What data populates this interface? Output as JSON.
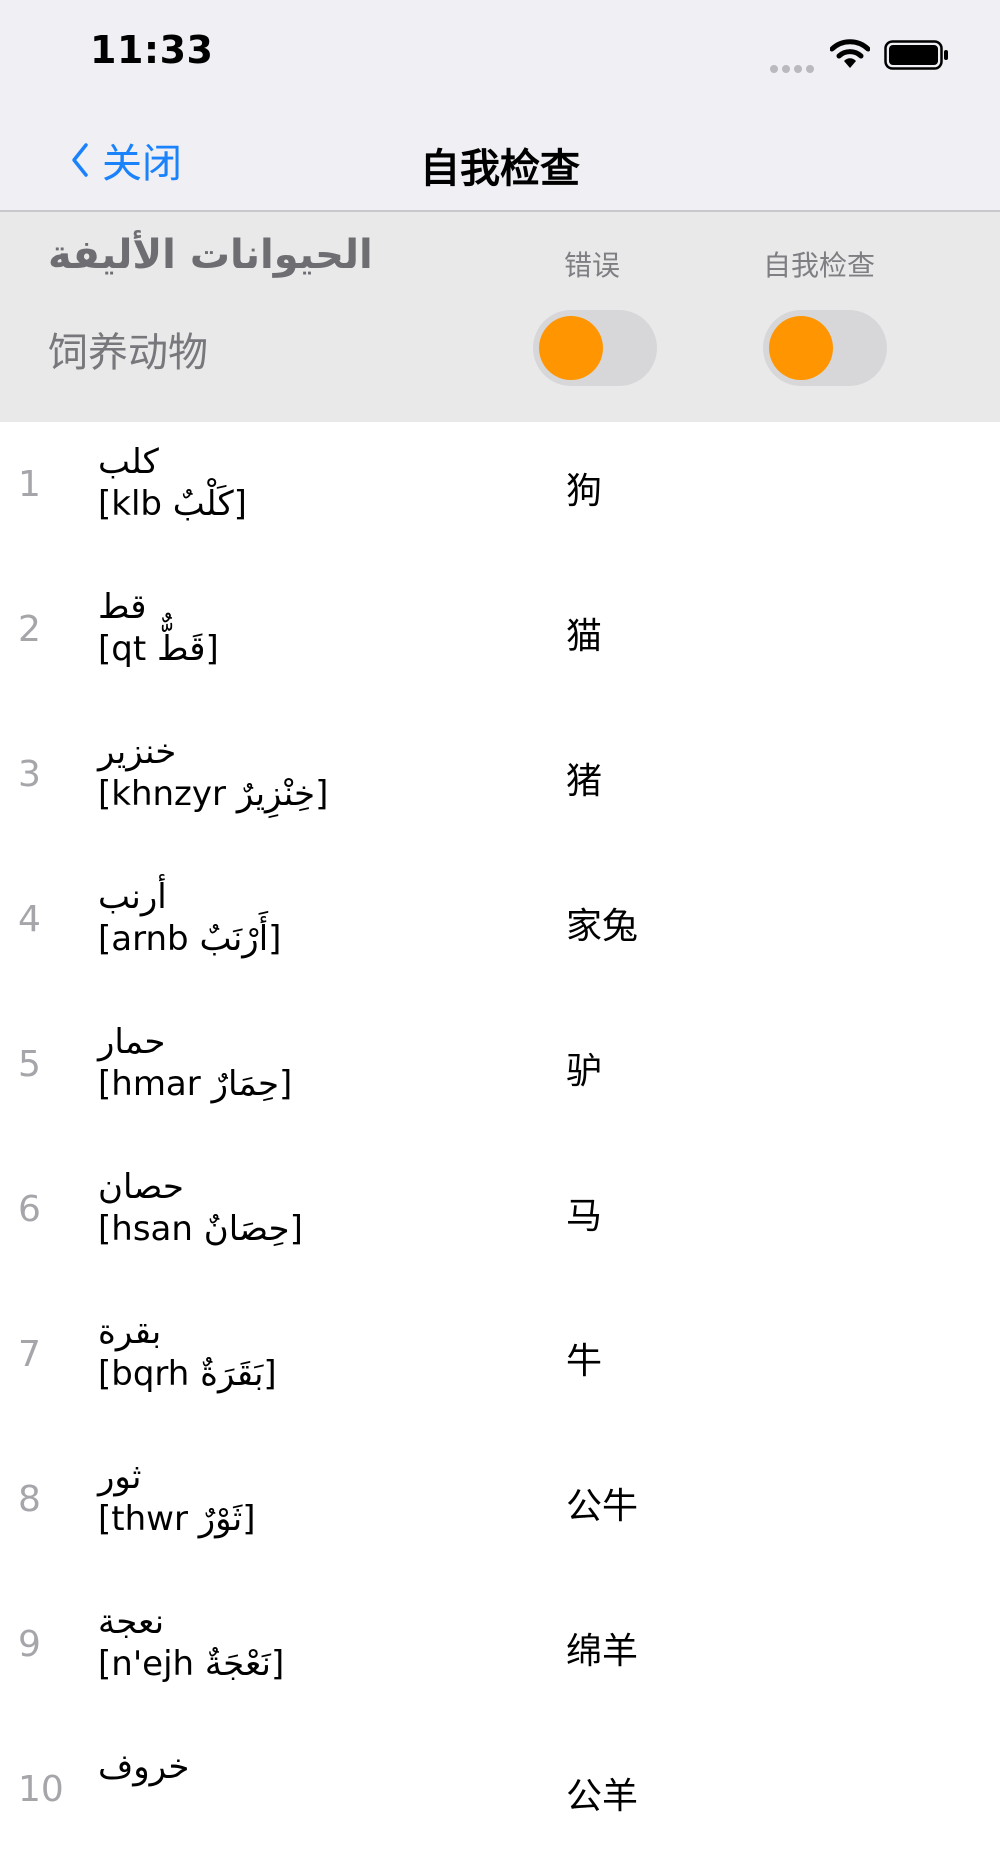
{
  "status_bar": {
    "time": "11:33"
  },
  "nav": {
    "back_label": "关闭",
    "title": "自我检查"
  },
  "header": {
    "lesson_arabic": "الحيوانات الأليفة",
    "lesson_chinese": "饲养动物",
    "errors_label": "错误",
    "self_check_label": "自我检查",
    "accent_color": "#ff9500",
    "link_color": "#1a82fb"
  },
  "words": [
    {
      "num": "1",
      "arabic": "كلب",
      "translit": "klb",
      "vocalized": "كَلْبٌ",
      "chinese": "狗"
    },
    {
      "num": "2",
      "arabic": "قط",
      "translit": "qt",
      "vocalized": "قَطٌّ",
      "chinese": "猫"
    },
    {
      "num": "3",
      "arabic": "خنزير",
      "translit": "khnzyr",
      "vocalized": "خِنْزِيرٌ",
      "chinese": "猪"
    },
    {
      "num": "4",
      "arabic": "أرنب",
      "translit": "arnb",
      "vocalized": "أَرْنَبٌ",
      "chinese": "家兔"
    },
    {
      "num": "5",
      "arabic": "حمار",
      "translit": "hmar",
      "vocalized": "حِمَارٌ",
      "chinese": "驴"
    },
    {
      "num": "6",
      "arabic": "حصان",
      "translit": "hsan",
      "vocalized": "حِصَانٌ",
      "chinese": "马"
    },
    {
      "num": "7",
      "arabic": "بقرة",
      "translit": "bqrh",
      "vocalized": "بَقَرَةٌ",
      "chinese": "牛"
    },
    {
      "num": "8",
      "arabic": "ثور",
      "translit": "thwr",
      "vocalized": "ثَوْرٌ",
      "chinese": "公牛"
    },
    {
      "num": "9",
      "arabic": "نعجة",
      "translit": "n'ejh",
      "vocalized": "نَعْجَةٌ",
      "chinese": "绵羊"
    },
    {
      "num": "10",
      "arabic": "خروف",
      "translit": "",
      "vocalized": "",
      "chinese": "公羊"
    }
  ]
}
